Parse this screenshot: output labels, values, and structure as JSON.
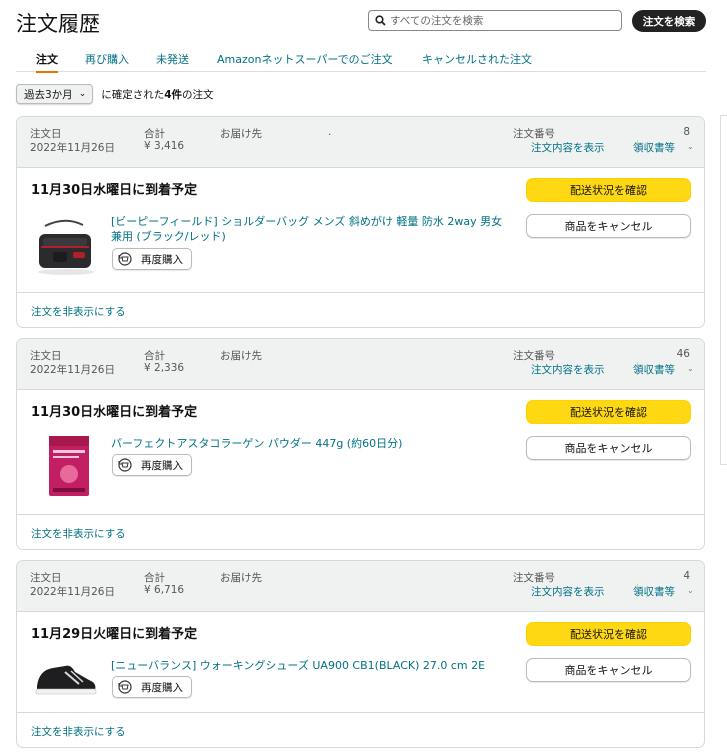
{
  "page": {
    "title": "注文履歴"
  },
  "search": {
    "placeholder": "すべての注文を検索",
    "button": "注文を検索"
  },
  "tabs": [
    "注文",
    "再び購入",
    "未発送",
    "Amazonネットスーパーでのご注文",
    "キャンセルされた注文"
  ],
  "filter": {
    "period": "過去3か月",
    "text_prefix": "に確定された",
    "count": "4件",
    "text_suffix": "の注文"
  },
  "labels": {
    "order_date": "注文日",
    "total": "合計",
    "ship_to": "お届け先",
    "order_number": "注文番号",
    "view_details": "注文内容を表示",
    "receipt": "領収書等",
    "track": "配送状況を確認",
    "cancel": "商品をキャンセル",
    "rebuy": "再度購入",
    "hide": "注文を非表示にする"
  },
  "orders": [
    {
      "date": "2022年11月26日",
      "total": "¥ 3,416",
      "ship_to_value": ".",
      "order_number": "8",
      "delivery": "11月30日水曜日に到着予定",
      "product": "[ビーピーフィールド] ショルダーバッグ メンズ 斜めがけ 軽量 防水 2way 男女兼用 (ブラック/レッド)",
      "image": "black-red-shoulder-bag"
    },
    {
      "date": "2022年11月26日",
      "total": "¥ 2,336",
      "ship_to_value": "",
      "order_number": "46",
      "delivery": "11月30日水曜日に到着予定",
      "product": "パーフェクトアスタコラーゲン パウダー 447g (約60日分)",
      "image": "pink-collagen-pouch"
    },
    {
      "date": "2022年11月26日",
      "total": "¥ 6,716",
      "ship_to_value": "",
      "order_number": "4",
      "delivery": "11月29日火曜日に到着予定",
      "product": "[ニューバランス] ウォーキングシューズ UA900 CB1(BLACK) 27.0 cm 2E",
      "image": "black-walking-shoe"
    }
  ]
}
